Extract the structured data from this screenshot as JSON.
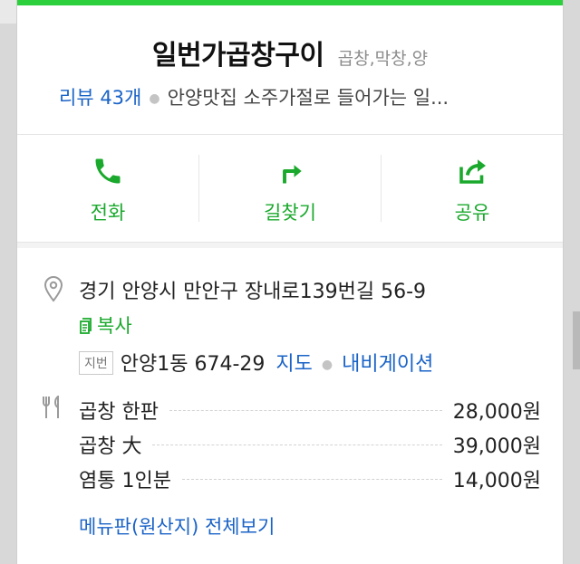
{
  "place": {
    "name": "일번가곱창구이",
    "category": "곱창,막창,양",
    "review_label": "리뷰 43개",
    "description": "안양맛집 소주가절로 들어가는 일..."
  },
  "actions": [
    {
      "label": "전화",
      "icon": "phone-icon"
    },
    {
      "label": "길찾기",
      "icon": "directions-icon"
    },
    {
      "label": "공유",
      "icon": "share-icon"
    }
  ],
  "address": {
    "road": "경기 안양시 만안구 장내로139번길 56-9",
    "copy_label": "복사",
    "jibun_badge": "지번",
    "jibun": "안양1동 674-29",
    "map_link": "지도",
    "nav_link": "내비게이션"
  },
  "menu": {
    "items": [
      {
        "name": "곱창 한판",
        "price": "28,000원"
      },
      {
        "name": "곱창 大",
        "price": "39,000원"
      },
      {
        "name": "염통 1인분",
        "price": "14,000원"
      }
    ],
    "view_all": "메뉴판(원산지) 전체보기"
  },
  "colors": {
    "accent": "#1aa92c",
    "link": "#1a63c7",
    "topbar": "#2ccf3c"
  }
}
